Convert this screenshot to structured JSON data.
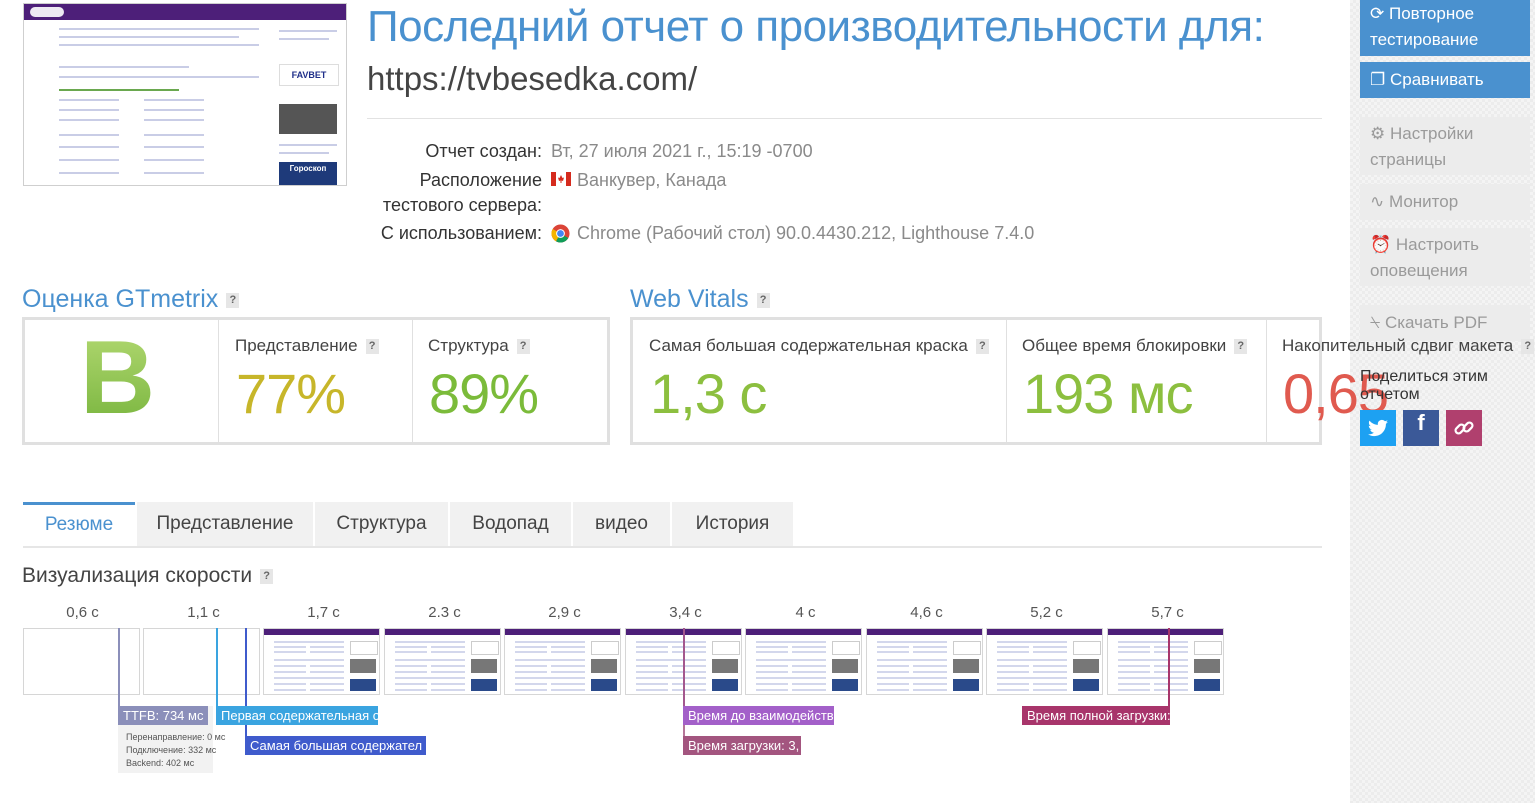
{
  "report": {
    "title": "Последний отчет о производительности для:",
    "url": "https://tvbesedka.com/",
    "created_label": "Отчет создан:",
    "created_value": "Вт, 27 июля 2021 г., 15:19 -0700",
    "location_label_1": "Расположение",
    "location_label_2": "тестового сервера:",
    "location_value": "Ванкувер, Канада",
    "using_label": "С использованием:",
    "using_value": "Chrome (Рабочий стол) 90.0.4430.212, Lighthouse 7.4.0"
  },
  "thumbnail": {
    "favbet": "FAVBET",
    "horoscope": "Гороскоп"
  },
  "gtmetrix": {
    "title": "Оценка GTmetrix",
    "help": "?",
    "grade": "B",
    "performance_label": "Представление",
    "performance_value": "77%",
    "structure_label": "Структура",
    "structure_value": "89%",
    "colors": {
      "grade": "#8cc63f",
      "performance": "#c7b62a",
      "structure": "#7bbb3a"
    }
  },
  "web_vitals": {
    "title": "Web Vitals",
    "help": "?",
    "lcp_label": "Самая большая содержательная краска",
    "lcp_value": "1,3 с",
    "tbt_label": "Общее время блокировки",
    "tbt_value": "193 мс",
    "cls_label": "Накопительный сдвиг макета",
    "cls_value": "0,65",
    "colors": {
      "good": "#8cbf3f",
      "bad": "#e05a4f"
    }
  },
  "tabs": [
    "Резюме",
    "Представление",
    "Структура",
    "Водопад",
    "видео",
    "История"
  ],
  "speed": {
    "title": "Визуализация скорости",
    "help": "?",
    "times": [
      "0,6 с",
      "1,1 с",
      "1,7 с",
      "2.3 с",
      "2,9 с",
      "3,4 с",
      "4 с",
      "4,6 с",
      "5,2 с",
      "5,7 с"
    ],
    "markers": {
      "ttfb": "TTFB: 734 мс",
      "fcp": "Первая содержательная о",
      "lcp": "Самая большая содержател",
      "tti": "Время до взаимодейств",
      "onload": "Время загрузки: 3,",
      "fully_loaded": "Время полной загрузки:"
    },
    "ttfb_details": {
      "redirect": "Перенаправление: 0 мс",
      "connect": "Подключение: 332 мс",
      "backend": "Backend: 402 мс"
    },
    "marker_colors": {
      "ttfb": "#8b8fba",
      "fcp": "#3aa4e0",
      "lcp": "#3f5bcc",
      "tti": "#a360c9",
      "onload": "#a3557f",
      "fully_loaded": "#a8356b"
    }
  },
  "sidebar": {
    "retest_1": "Повторное",
    "retest_2": "тестирование",
    "compare": "Сравнивать",
    "page_settings_1": "Настройки",
    "page_settings_2": "страницы",
    "monitor": "Монитор",
    "alerts_1": "Настроить",
    "alerts_2": "оповещения",
    "pdf": "Скачать PDF",
    "share_1": "Поделиться этим",
    "share_2": "отчетом",
    "share_icons": [
      "twitter-icon",
      "facebook-icon",
      "link-icon"
    ],
    "colors": {
      "twitter": "#1da1f2",
      "facebook": "#3b5998",
      "link": "#b0406e"
    }
  }
}
